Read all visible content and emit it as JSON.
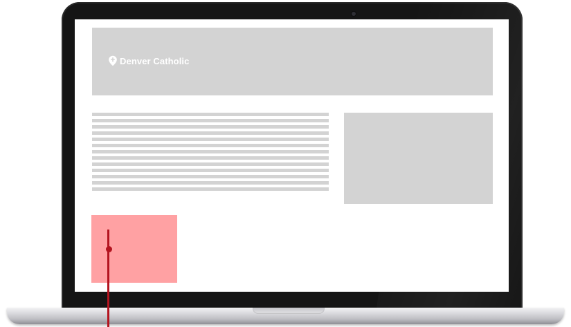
{
  "screen": {
    "brand": {
      "name": "Denver Catholic",
      "icon": "location-pin-cross-icon"
    },
    "text_lines_count": 13
  },
  "colors": {
    "placeholder_gray": "#d3d3d3",
    "highlight_pink": "#ffa1a3",
    "marker_red": "#b3141f",
    "bezel_black": "#151515"
  }
}
